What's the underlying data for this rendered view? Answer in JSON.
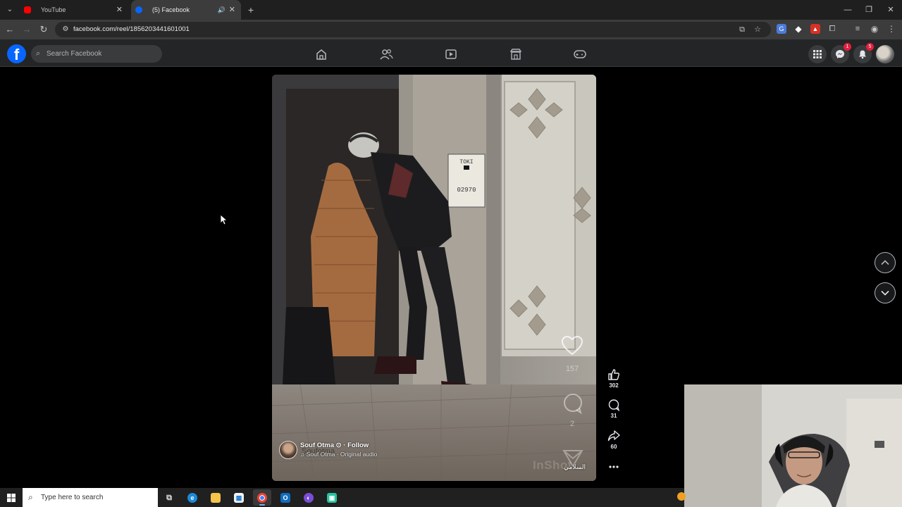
{
  "browser": {
    "tabs": [
      {
        "title": "YouTube",
        "favicon": "youtube-icon",
        "color": "#ff0000"
      },
      {
        "title": "(5) Facebook",
        "favicon": "facebook-icon",
        "color": "#0866ff",
        "active": true
      }
    ],
    "url": "facebook.com/reel/1856203441601001"
  },
  "facebook": {
    "search_placeholder": "Search Facebook",
    "nav": [
      "home-icon",
      "friends-icon",
      "video-icon",
      "marketplace-icon",
      "gaming-icon"
    ],
    "messenger_badge": "1",
    "notifications_badge": "5",
    "logo_letter": "f"
  },
  "reel": {
    "author": "Souf Otma",
    "verified_mark": "⊙",
    "separator": "·",
    "follow_label": "Follow",
    "audio_note": "♫",
    "audio_text": "Souf Otma · Original audio",
    "overlay_handle": "Soufotma",
    "overlay_like_count": "157",
    "overlay_comment_count": "2",
    "watermark": "InShot",
    "arabic_tag": "السلامي",
    "door_plate_top": "TOKI",
    "door_plate_number": "02970"
  },
  "actions": {
    "likes": "302",
    "comments": "31",
    "shares": "60"
  },
  "taskbar": {
    "search_placeholder": "Type here to search",
    "apps": [
      "task-view-icon",
      "edge-icon",
      "file-explorer-icon",
      "store-icon",
      "chrome-icon",
      "outlook-icon",
      "app-icon",
      "app-icon"
    ]
  },
  "colors": {
    "facebook_blue": "#0866ff",
    "header_bg": "#242526",
    "badge_red": "#e41e3f"
  }
}
